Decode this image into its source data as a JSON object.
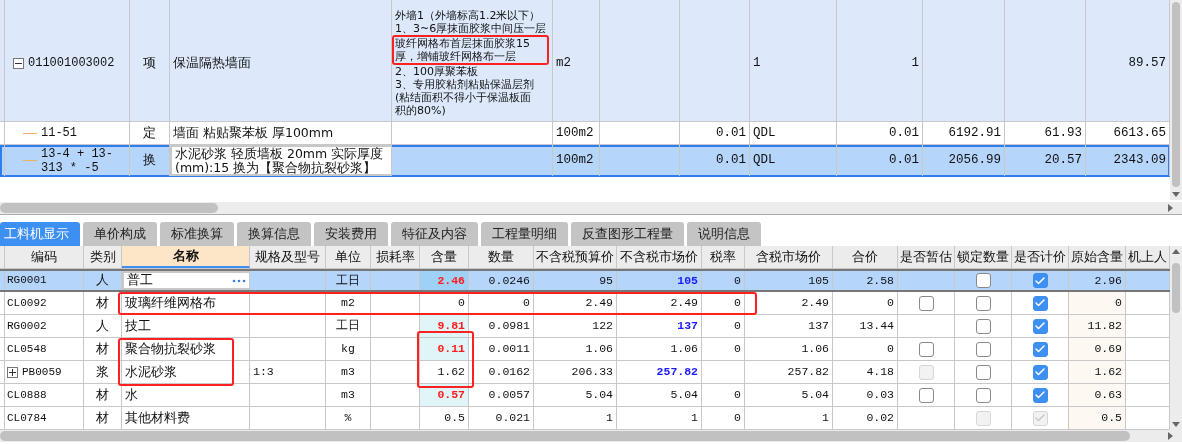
{
  "upper_table": {
    "rows": [
      {
        "kind": "item",
        "selected": false,
        "expanded": true,
        "code": "011001003002",
        "category": "项",
        "name": "保温隔热墙面",
        "description": [
          {
            "text": "外墙1（外墙标高1.2米以下）",
            "highlighted": false
          },
          {
            "text": "1、3~6厚抹面胶浆中间压一层",
            "highlighted": false
          },
          {
            "text": "玻纤网格布首层抹面胶浆15",
            "highlighted": true
          },
          {
            "text": "厚，增铺玻纤网格布一层",
            "highlighted": true
          },
          {
            "text": "2、100厚聚苯板",
            "highlighted": false
          },
          {
            "text": "3、专用胶粘剂粘贴保温层剂",
            "highlighted": false
          },
          {
            "text": "(粘结面积不得小于保温板面",
            "highlighted": false
          },
          {
            "text": "积的80%)",
            "highlighted": false
          }
        ],
        "unit": "m2",
        "cells": [
          null,
          null,
          "1",
          "1",
          null,
          null,
          "89.57"
        ]
      },
      {
        "kind": "quota",
        "selected": false,
        "code": "11-51",
        "category": "定",
        "name": "墙面 粘贴聚苯板 厚100mm",
        "unit": "100m2",
        "cells": [
          null,
          "0.01",
          "QDL",
          "0.01",
          "6192.91",
          "61.93",
          "6613.65"
        ]
      },
      {
        "kind": "quota",
        "selected": true,
        "code": "13-4 + 13-313 * -5",
        "category": "换",
        "name": "水泥砂浆 轻质墙板 20mm  实际厚度(mm):15  换为【聚合物抗裂砂浆】",
        "unit": "100m2",
        "cells": [
          null,
          "0.01",
          "QDL",
          "0.01",
          "2056.99",
          "20.57",
          "2343.09"
        ]
      }
    ]
  },
  "tabs": [
    {
      "label": "工料机显示",
      "selected": true
    },
    {
      "label": "单价构成",
      "selected": false
    },
    {
      "label": "标准换算",
      "selected": false
    },
    {
      "label": "换算信息",
      "selected": false
    },
    {
      "label": "安装费用",
      "selected": false
    },
    {
      "label": "特征及内容",
      "selected": false
    },
    {
      "label": "工程量明细",
      "selected": false
    },
    {
      "label": "反查图形工程量",
      "selected": false
    },
    {
      "label": "说明信息",
      "selected": false
    }
  ],
  "resource_table": {
    "columns": [
      {
        "label": "编码",
        "sorted": false
      },
      {
        "label": "类别",
        "sorted": false
      },
      {
        "label": "名称",
        "sorted": true
      },
      {
        "label": "规格及型号",
        "sorted": false
      },
      {
        "label": "单位",
        "sorted": false
      },
      {
        "label": "损耗率",
        "sorted": false
      },
      {
        "label": "含量",
        "sorted": false
      },
      {
        "label": "数量",
        "sorted": false
      },
      {
        "label": "不含税预算价",
        "sorted": false
      },
      {
        "label": "不含税市场价",
        "sorted": false
      },
      {
        "label": "税率",
        "sorted": false
      },
      {
        "label": "含税市场价",
        "sorted": false
      },
      {
        "label": "合价",
        "sorted": false
      },
      {
        "label": "是否暂估",
        "sorted": false
      },
      {
        "label": "锁定数量",
        "sorted": false
      },
      {
        "label": "是否计价",
        "sorted": false
      },
      {
        "label": "原始含量",
        "sorted": false
      },
      {
        "label": "机上人",
        "sorted": false
      }
    ],
    "rows": [
      {
        "selected": true,
        "editing": true,
        "code": "RG0001",
        "category": "人",
        "name": "普工",
        "unit": "工日",
        "content": "2.46",
        "content_changed": true,
        "quantity": "0.0246",
        "budget_price": "95",
        "market_price": "105",
        "price_adjusted": true,
        "tax_rate": "0",
        "tax_market_price": "105",
        "total": "2.58",
        "locked": {
          "checked": false,
          "disabled": false
        },
        "priced": {
          "checked": true,
          "disabled": false
        },
        "original_content": "2.96"
      },
      {
        "selected": false,
        "editing": false,
        "code": "CL0092",
        "category": "材",
        "name": "玻璃纤维网格布",
        "unit": "m2",
        "content": "0",
        "content_changed": false,
        "quantity": "0",
        "budget_price": "2.49",
        "market_price": "2.49",
        "price_adjusted": false,
        "tax_rate": "0",
        "tax_market_price": "2.49",
        "total": "0",
        "provisional": {
          "checked": false,
          "disabled": false
        },
        "locked": {
          "checked": false,
          "disabled": false
        },
        "priced": {
          "checked": true,
          "disabled": false
        },
        "original_content": "0"
      },
      {
        "selected": false,
        "editing": false,
        "code": "RG0002",
        "category": "人",
        "name": "技工",
        "unit": "工日",
        "content": "9.81",
        "content_changed": true,
        "quantity": "0.0981",
        "budget_price": "122",
        "market_price": "137",
        "price_adjusted": true,
        "tax_rate": "0",
        "tax_market_price": "137",
        "total": "13.44",
        "locked": {
          "checked": false,
          "disabled": false
        },
        "priced": {
          "checked": true,
          "disabled": false
        },
        "original_content": "11.82"
      },
      {
        "selected": false,
        "editing": false,
        "code": "CL0548",
        "category": "材",
        "name": "聚合物抗裂砂浆",
        "unit": "kg",
        "content": "0.11",
        "content_changed": true,
        "quantity": "0.0011",
        "budget_price": "1.06",
        "market_price": "1.06",
        "price_adjusted": false,
        "tax_rate": "0",
        "tax_market_price": "1.06",
        "total": "0",
        "provisional": {
          "checked": false,
          "disabled": false
        },
        "locked": {
          "checked": false,
          "disabled": false
        },
        "priced": {
          "checked": true,
          "disabled": false
        },
        "original_content": "0.69"
      },
      {
        "selected": false,
        "editing": false,
        "expanded": false,
        "code": "PB0059",
        "category": "浆",
        "name": "水泥砂浆",
        "spec": "1:3",
        "unit": "m3",
        "content": "1.62",
        "content_changed": false,
        "quantity": "0.0162",
        "budget_price": "206.33",
        "market_price": "257.82",
        "price_adjusted": true,
        "tax_market_price": "257.82",
        "total": "4.18",
        "provisional": {
          "checked": false,
          "disabled": true
        },
        "locked": {
          "checked": false,
          "disabled": false
        },
        "priced": {
          "checked": true,
          "disabled": false
        },
        "original_content": "1.62"
      },
      {
        "selected": false,
        "editing": false,
        "code": "CL0888",
        "category": "材",
        "name": "水",
        "unit": "m3",
        "content": "0.57",
        "content_changed": true,
        "quantity": "0.0057",
        "budget_price": "5.04",
        "market_price": "5.04",
        "price_adjusted": false,
        "tax_rate": "0",
        "tax_market_price": "5.04",
        "total": "0.03",
        "provisional": {
          "checked": false,
          "disabled": false
        },
        "locked": {
          "checked": false,
          "disabled": false
        },
        "priced": {
          "checked": true,
          "disabled": false
        },
        "original_content": "0.63"
      },
      {
        "selected": false,
        "editing": false,
        "code": "CL0784",
        "category": "材",
        "name": "其他材料费",
        "unit": "%",
        "content": "0.5",
        "content_changed": false,
        "quantity": "0.021",
        "budget_price": "1",
        "market_price": "1",
        "price_adjusted": false,
        "tax_rate": "0",
        "tax_market_price": "1",
        "total": "0.02",
        "locked": {
          "checked": false,
          "disabled": true
        },
        "priced": {
          "checked": true,
          "disabled": true
        },
        "original_content": "0.5"
      }
    ]
  }
}
